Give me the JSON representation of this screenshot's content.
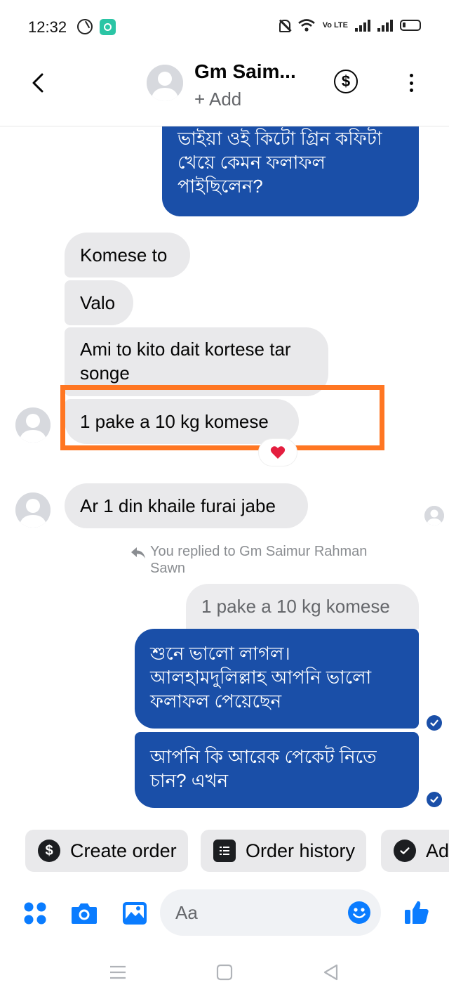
{
  "status_bar": {
    "time": "12:32",
    "volte": "Vo LTE"
  },
  "header": {
    "name": "Gm Saim...",
    "subtitle": "+ Add",
    "icons": [
      "back-arrow-icon",
      "dollar-icon",
      "more-vertical-icon"
    ]
  },
  "messages": [
    {
      "dir": "out",
      "text_lines": [
        "ভাইয়া ওই কিটো গ্রিন কফিটা",
        "খেয়ে কেমন ফলাফল",
        "পাইছিলেন?"
      ]
    },
    {
      "dir": "in",
      "text": "Komese to"
    },
    {
      "dir": "in",
      "text": "Valo"
    },
    {
      "dir": "in",
      "text_lines": [
        "Ami to kito dait kortese tar",
        "songe"
      ]
    },
    {
      "dir": "in",
      "text": "1 pake a 10 kg komese",
      "highlighted": true,
      "reaction": "heart"
    },
    {
      "dir": "in",
      "text": "Ar 1 din khaile furai jabe"
    }
  ],
  "reply": {
    "label_lines": [
      "You replied to Gm Saimur Rahman",
      "Sawn"
    ],
    "quoted": "1 pake a 10 kg komese"
  },
  "outgoing": [
    {
      "text_lines": [
        "শুনে ভালো লাগল।",
        "আলহামদুলিল্লাহ আপনি ভালো",
        "ফলাফল পেয়েছেন"
      ]
    },
    {
      "text_lines": [
        "আপনি কি আরেক পেকেট নিতে",
        "চান? এখন"
      ]
    }
  ],
  "chips": [
    {
      "label": "Create order",
      "icon": "dollar-circle-icon"
    },
    {
      "label": "Order history",
      "icon": "receipt-icon"
    },
    {
      "label": "Ad",
      "icon": "check-circle-icon"
    }
  ],
  "composer": {
    "placeholder": "Aa"
  },
  "colors": {
    "accent": "#1a4fa8",
    "messenger_blue": "#0a7cff",
    "highlight": "#ff7622",
    "incoming_bg": "#e9e9eb"
  }
}
